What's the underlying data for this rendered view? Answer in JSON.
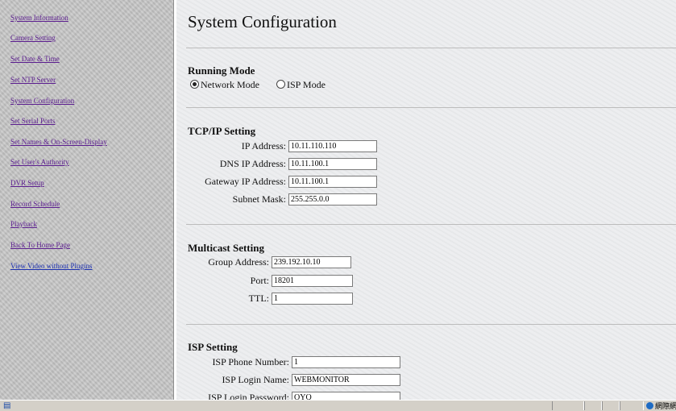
{
  "sidebar": {
    "items": [
      {
        "label": "System Information"
      },
      {
        "label": "Camera Setting"
      },
      {
        "label": "Set Date & Time"
      },
      {
        "label": "Set NTP Server"
      },
      {
        "label": "System Configuration"
      },
      {
        "label": "Set Serial Ports"
      },
      {
        "label": "Set Names & On-Screen-Display"
      },
      {
        "label": "Set User's Authority"
      },
      {
        "label": "DVR Setup"
      },
      {
        "label": "Record Schedule"
      },
      {
        "label": "Playback"
      },
      {
        "label": "Back To Home Page"
      },
      {
        "label": "View Video without Plugins"
      }
    ]
  },
  "page": {
    "title": "System Configuration"
  },
  "running_mode": {
    "heading": "Running Mode",
    "options": [
      {
        "label": "Network Mode",
        "selected": true
      },
      {
        "label": "ISP Mode",
        "selected": false
      }
    ]
  },
  "tcpip": {
    "heading": "TCP/IP Setting",
    "fields": [
      {
        "label": "IP Address:",
        "value": "10.11.110.110"
      },
      {
        "label": "DNS IP Address:",
        "value": "10.11.100.1"
      },
      {
        "label": "Gateway IP Address:",
        "value": "10.11.100.1"
      },
      {
        "label": "Subnet Mask:",
        "value": "255.255.0.0"
      }
    ]
  },
  "multicast": {
    "heading": "Multicast Setting",
    "fields": [
      {
        "label": "Group Address:",
        "value": "239.192.10.10"
      },
      {
        "label": "Port:",
        "value": "18201"
      },
      {
        "label": "TTL:",
        "value": "1"
      }
    ]
  },
  "isp": {
    "heading": "ISP Setting",
    "fields": [
      {
        "label": "ISP Phone Number:",
        "value": "1"
      },
      {
        "label": "ISP Login Name:",
        "value": "WEBMONITOR"
      },
      {
        "label": "ISP Login Password:",
        "value": "OYQ"
      }
    ]
  },
  "statusbar": {
    "zone_label": "網際網路",
    "icon": "ie-page-icon",
    "zone_icon": "globe-icon"
  }
}
